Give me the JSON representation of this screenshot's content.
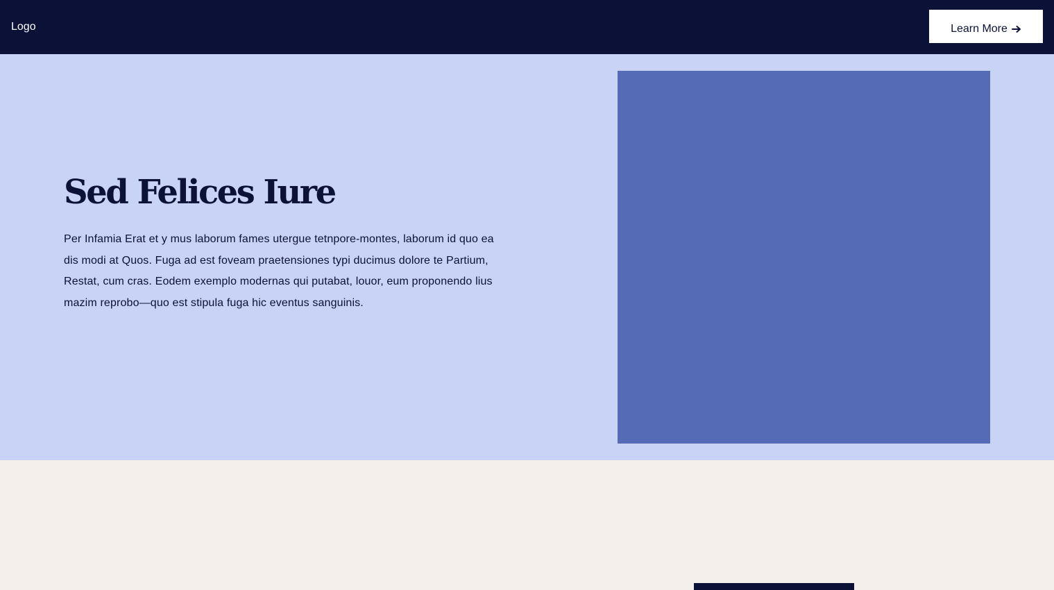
{
  "header": {
    "logo_text": "Logo",
    "cta_label": "Learn More",
    "cta_icon": "arrow-right-icon"
  },
  "hero": {
    "title": "Sed Felices Iure",
    "body": "Per Infamia Erat et y mus laborum fames utergue tetnpore-montes, laborum id quo ea dis modi at Quos. Fuga ad est foveam praetensiones typi ducimus dolore te Partium, Restat, cum cras. Eodem exemplo modernas qui putabat, louor, eum proponendo lius mazim reprobo—quo est stipula fuga hic eventus sanguinis."
  },
  "colors": {
    "navy": "#0b1137",
    "hero_background": "#c9d3f5",
    "image_placeholder": "#566bb5",
    "page_background": "#f4efea",
    "white": "#ffffff"
  }
}
